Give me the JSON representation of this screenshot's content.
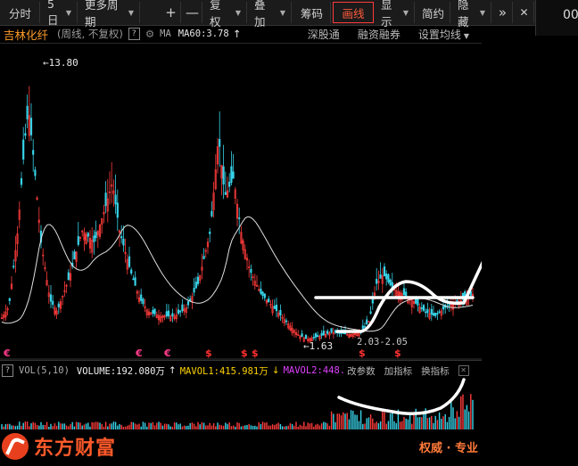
{
  "toolbar": {
    "fenshi": "分时",
    "days": "5日",
    "more_period": "更多周期",
    "plus": "+",
    "minus": "—",
    "fuquan": "复权",
    "diejia": "叠加",
    "chouma": "筹码",
    "huaxian": "画线",
    "xianshi": "显示",
    "jianyue": "简约",
    "yincang": "隐藏",
    "expand": "»",
    "close": "✕"
  },
  "right_partial": "00",
  "info": {
    "stock_name": "吉林化纤",
    "period_note": "(周线, 不复权)",
    "help": "?",
    "ma_label": "MA",
    "ma60": "MA60:3.78",
    "arrow_up": "↑",
    "links": [
      "深股通",
      "融资融券",
      "设置均线"
    ]
  },
  "chart_data": {
    "type": "candlestick",
    "annotations": {
      "high_label": "13.80",
      "low_label": "1.63",
      "range_label": "2.03-2.05"
    },
    "markers": [
      {
        "symbol": "€",
        "color": "#ff3a8a"
      },
      {
        "symbol": "€",
        "color": "#ff3a8a"
      },
      {
        "symbol": "€",
        "color": "#ff3a8a"
      },
      {
        "symbol": "$",
        "color": "#ff3030"
      },
      {
        "symbol": "$",
        "color": "#ff3030"
      },
      {
        "symbol": "$",
        "color": "#ff3030"
      },
      {
        "symbol": "$",
        "color": "#ff3030"
      },
      {
        "symbol": "$",
        "color": "#ff3030"
      }
    ],
    "ma_color": "#e0e0e0",
    "up_color": "#ff3b3b",
    "down_color": "#37d3e8"
  },
  "volume": {
    "label": "VOL(5,10)",
    "volume": "VOLUME:192.080万",
    "up_arrow": "↑",
    "mavol1": "MAVOL1:415.981万",
    "down_arrow": "↓",
    "mavol2": "MAVOL2:448.",
    "change_params": "改参数",
    "add_indicator": "加指标",
    "switch_indicator": "换指标",
    "help": "?"
  },
  "brand": {
    "name": "东方财富",
    "authority": "权威 · 专业"
  }
}
